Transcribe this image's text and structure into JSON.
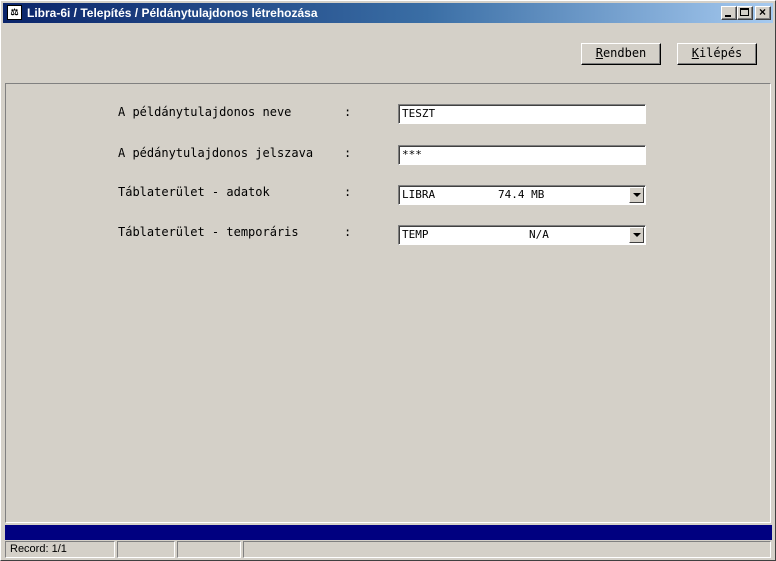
{
  "window": {
    "title": "Libra-6i / Telepítés / Példánytulajdonos létrehozása",
    "app_icon": "libra-app-icon"
  },
  "toolbar": {
    "ok_label_first": "R",
    "ok_label_rest": "endben",
    "exit_label_first": "K",
    "exit_label_rest": "ilépés"
  },
  "form": {
    "owner_name_label": "A példánytulajdonos neve",
    "owner_name_value": "TESZT",
    "owner_password_label": "A pédánytulajdonos jelszava",
    "owner_password_value": "***",
    "tablespace_data_label": "Táblaterület - adatok",
    "tablespace_data_name": "LIBRA",
    "tablespace_data_size": "74.4 MB",
    "tablespace_temp_label": "Táblaterület - temporáris",
    "tablespace_temp_name": "TEMP",
    "tablespace_temp_size": "N/A",
    "colon": ":"
  },
  "statusbar": {
    "record": "Record: 1/1"
  }
}
